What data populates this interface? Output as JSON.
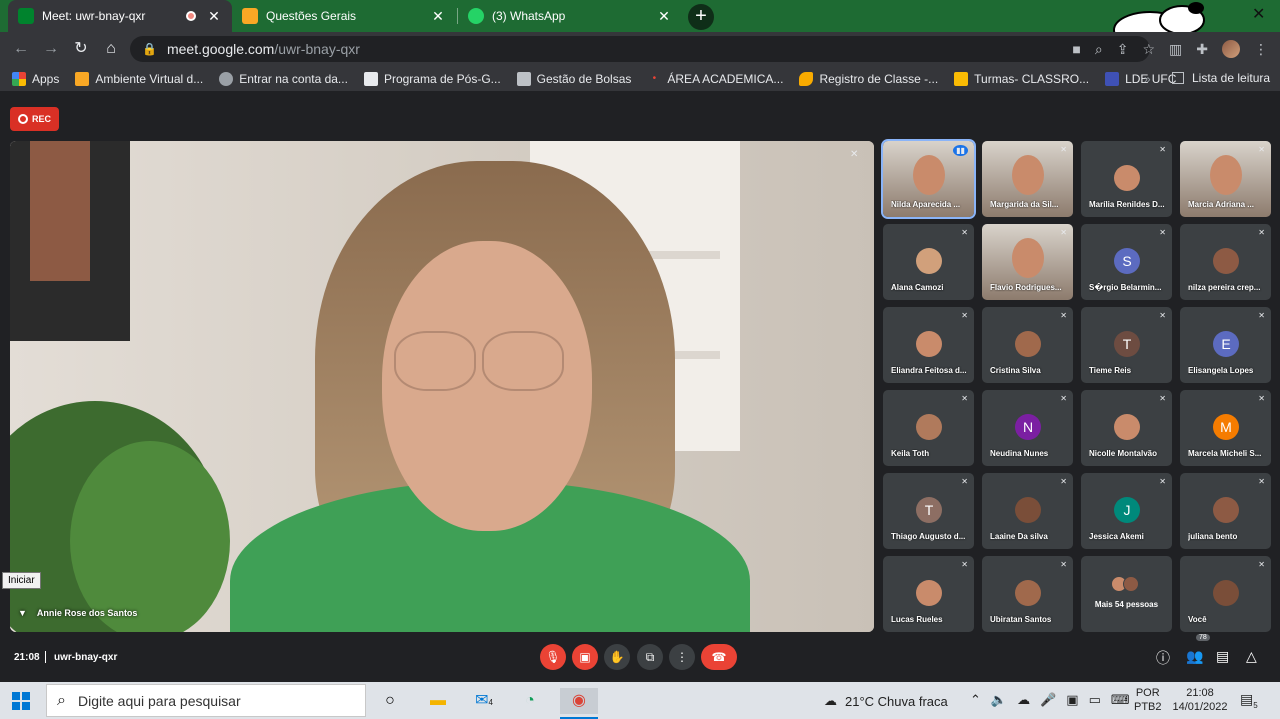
{
  "tabs": [
    {
      "title": "Meet: uwr-bnay-qxr",
      "active": true
    },
    {
      "title": "Questões Gerais",
      "active": false
    },
    {
      "title": "(3) WhatsApp",
      "active": false
    }
  ],
  "address": {
    "host": "meet.google.com",
    "path": "/uwr-bnay-qxr"
  },
  "bookmarks": [
    "Apps",
    "Ambiente Virtual d...",
    "Entrar na conta da...",
    "Programa de Pós-G...",
    "Gestão de Bolsas",
    "ÁREA ACADEMICA...",
    "Registro de Classe -...",
    "Turmas- CLASSRO...",
    "LDE UFC"
  ],
  "bookmarks_more": "»",
  "reading_list": "Lista de leitura",
  "meet": {
    "rec_label": "REC",
    "main_speaker": "Annie Rose dos Santos",
    "participants": [
      {
        "name": "Nilda Aparecida ...",
        "type": "video",
        "speaking": true
      },
      {
        "name": "Margarida da Sil...",
        "type": "video"
      },
      {
        "name": "Marília Renildes D...",
        "type": "photo"
      },
      {
        "name": "Marcia Adriana ...",
        "type": "video"
      },
      {
        "name": "Alana Camozi",
        "type": "photo"
      },
      {
        "name": "Flavio Rodrigues...",
        "type": "video"
      },
      {
        "name": "S�rgio Belarmin...",
        "type": "letter",
        "letter": "S",
        "color": "#5c6bc0"
      },
      {
        "name": "nilza pereira crep...",
        "type": "photo"
      },
      {
        "name": "Eliandra Feitosa d...",
        "type": "photo"
      },
      {
        "name": "Cristina Silva",
        "type": "photo"
      },
      {
        "name": "Tieme Reis",
        "type": "letter",
        "letter": "T",
        "color": "#6d4c41"
      },
      {
        "name": "Elisangela Lopes",
        "type": "letter",
        "letter": "E",
        "color": "#5c6bc0"
      },
      {
        "name": "Keila Toth",
        "type": "photo"
      },
      {
        "name": "Neudina Nunes",
        "type": "letter",
        "letter": "N",
        "color": "#7b1fa2"
      },
      {
        "name": "Nicolle Montalvão",
        "type": "photo"
      },
      {
        "name": "Marcela Micheli S...",
        "type": "letter",
        "letter": "M",
        "color": "#f57c00"
      },
      {
        "name": "Thiago Augusto d...",
        "type": "letter",
        "letter": "T",
        "color": "#8d6e63"
      },
      {
        "name": "Laaine Da silva",
        "type": "photo"
      },
      {
        "name": "Jessica Akemi",
        "type": "letter",
        "letter": "J",
        "color": "#00897b"
      },
      {
        "name": "juliana bento",
        "type": "photo"
      },
      {
        "name": "Lucas Rueles",
        "type": "photo"
      },
      {
        "name": "Ubiratan Santos",
        "type": "photo"
      },
      {
        "name": "Mais 54 pessoas",
        "type": "more"
      },
      {
        "name": "Você",
        "type": "photo"
      }
    ],
    "time": "21:08",
    "meeting_code": "uwr-bnay-qxr",
    "participant_count": "78"
  },
  "tooltip": "Iniciar",
  "taskbar": {
    "search_placeholder": "Digite aqui para pesquisar",
    "mail_badge": "4",
    "weather": "21°C  Chuva fraca",
    "lang_top": "POR",
    "lang_bottom": "PTB2",
    "clock_time": "21:08",
    "clock_date": "14/01/2022",
    "notif_count": "5"
  },
  "colors": {
    "accent": "#1e6b33",
    "meet_bg": "#202124",
    "danger": "#ea4335",
    "speaking": "#8ab4f8"
  }
}
